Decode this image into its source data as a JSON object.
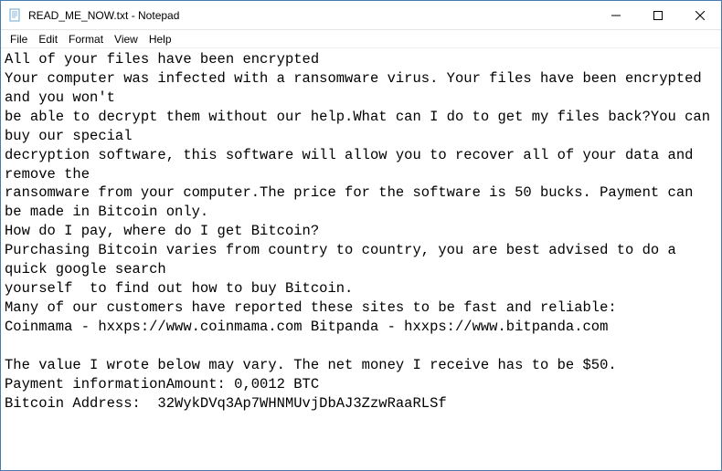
{
  "window": {
    "title": "READ_ME_NOW.txt - Notepad"
  },
  "menu": {
    "file": "File",
    "edit": "Edit",
    "format": "Format",
    "view": "View",
    "help": "Help"
  },
  "content": {
    "text": "All of your files have been encrypted\nYour computer was infected with a ransomware virus. Your files have been encrypted and you won't\nbe able to decrypt them without our help.What can I do to get my files back?You can buy our special\ndecryption software, this software will allow you to recover all of your data and remove the\nransomware from your computer.The price for the software is 50 bucks. Payment can be made in Bitcoin only.\nHow do I pay, where do I get Bitcoin?\nPurchasing Bitcoin varies from country to country, you are best advised to do a quick google search\nyourself  to find out how to buy Bitcoin.\nMany of our customers have reported these sites to be fast and reliable:\nCoinmama - hxxps://www.coinmama.com Bitpanda - hxxps://www.bitpanda.com\n\nThe value I wrote below may vary. The net money I receive has to be $50.\nPayment informationAmount: 0,0012 BTC\nBitcoin Address:  32WykDVq3Ap7WHNMUvjDbAJ3ZzwRaaRLSf"
  }
}
